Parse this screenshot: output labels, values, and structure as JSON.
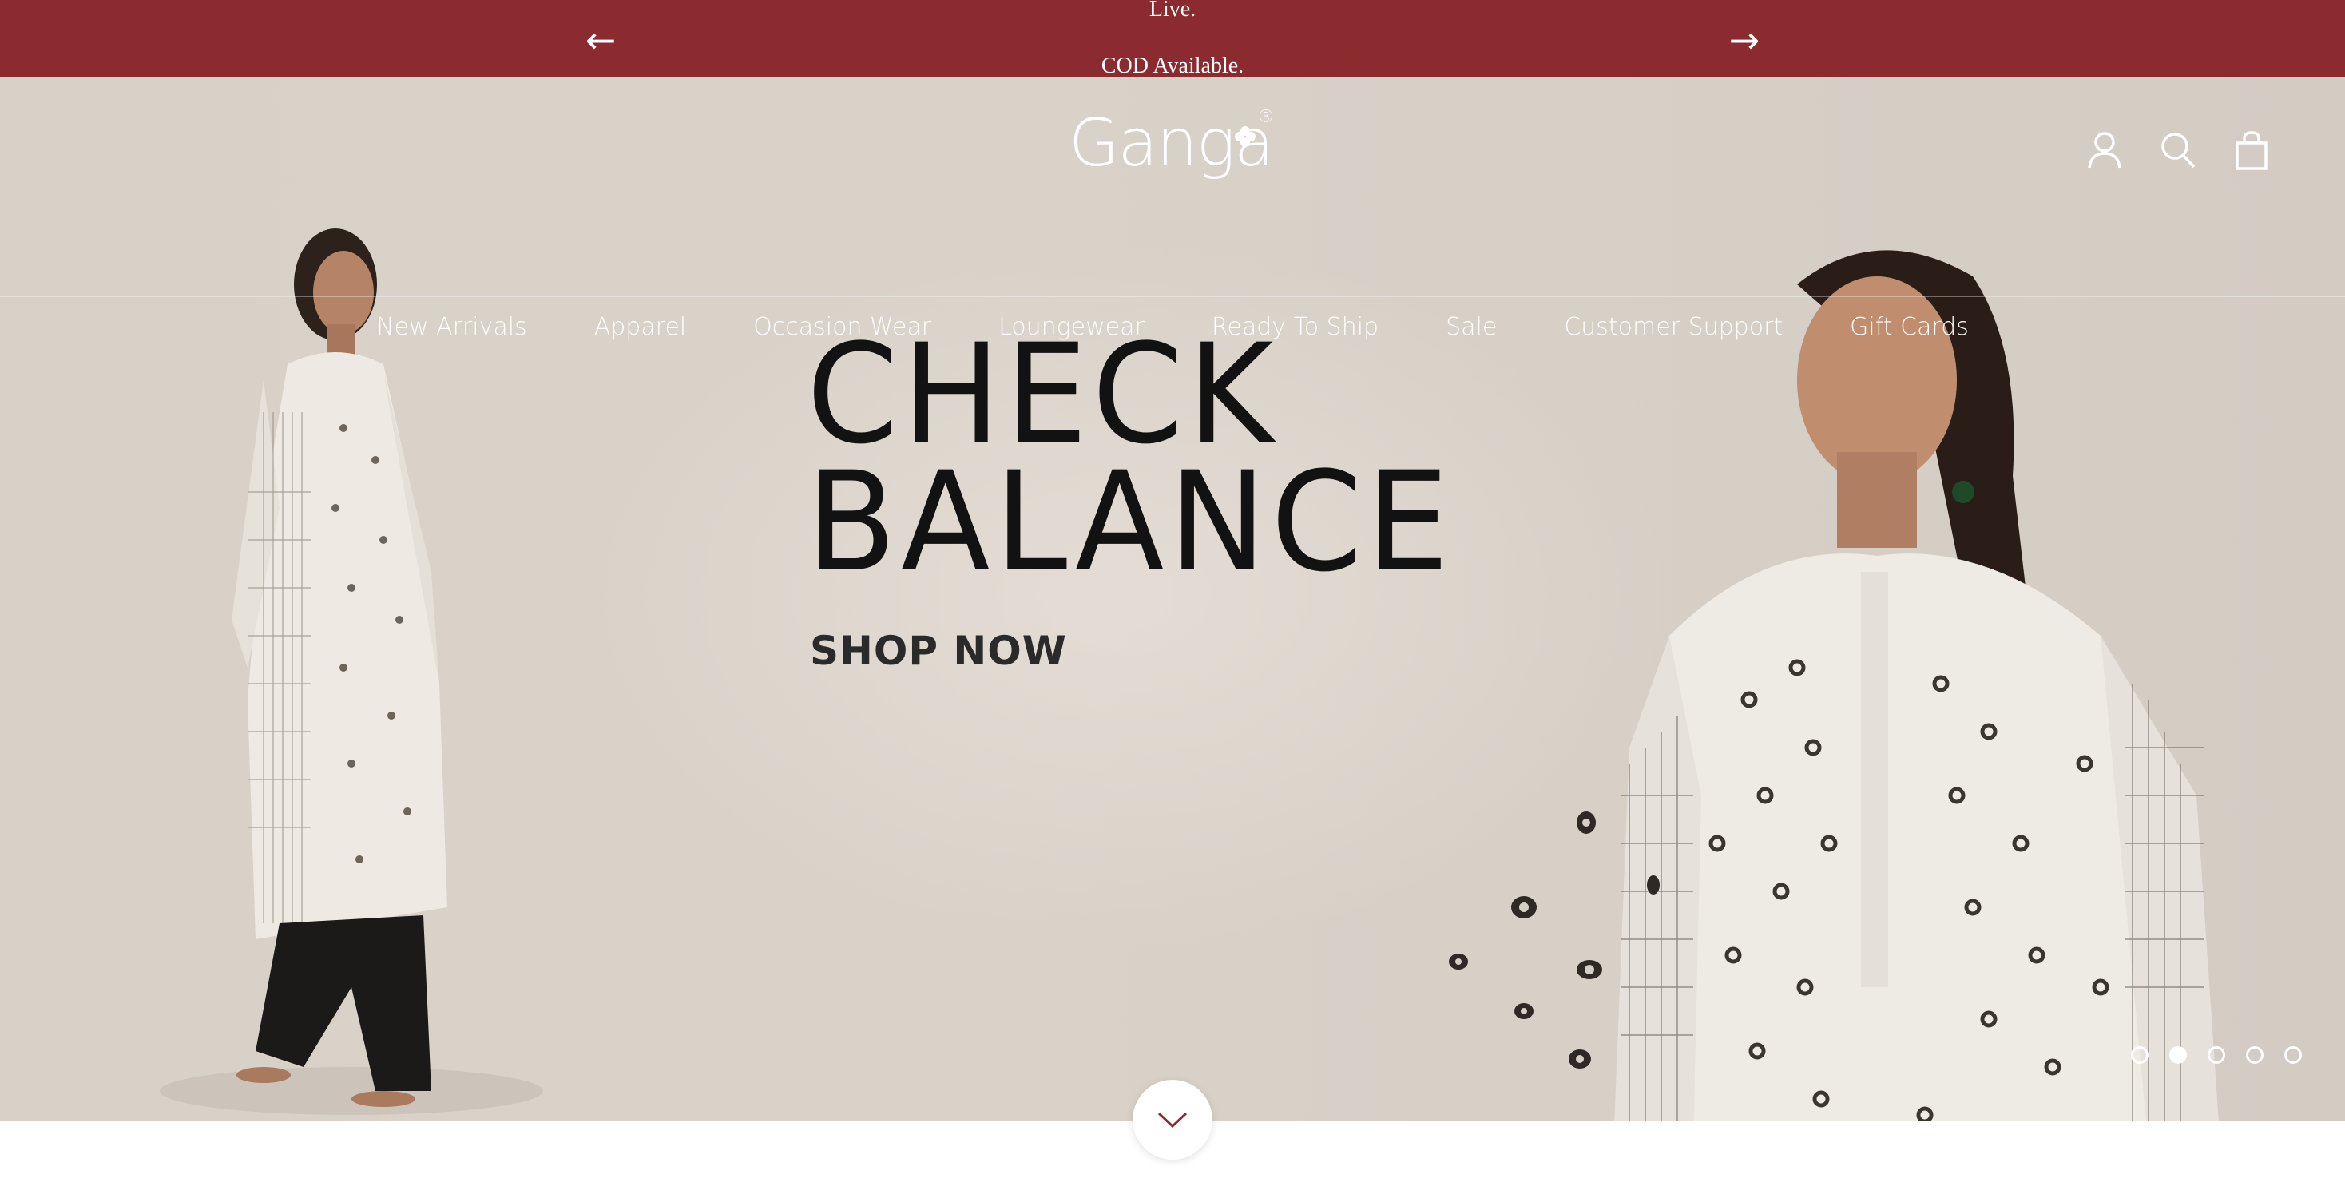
{
  "announcement": {
    "line1": "Live.",
    "line2": "COD Available.",
    "prev_icon": "arrow-left-icon",
    "next_icon": "arrow-right-icon"
  },
  "header": {
    "logo_text": "Ganga",
    "logo_mark": "®",
    "icons": [
      "account-icon",
      "search-icon",
      "cart-icon"
    ]
  },
  "nav": {
    "items": [
      {
        "label": "New Arrivals"
      },
      {
        "label": "Apparel"
      },
      {
        "label": "Occasion Wear"
      },
      {
        "label": "Loungewear"
      },
      {
        "label": "Ready To Ship"
      },
      {
        "label": "Sale"
      },
      {
        "label": "Customer Support"
      },
      {
        "label": "Gift Cards"
      }
    ]
  },
  "hero": {
    "headline_line1": "CHECK",
    "headline_line2": "BALANCE",
    "cta": "SHOP NOW",
    "slides_count": 5,
    "active_slide": 2
  },
  "colors": {
    "announcement_bg": "#8b2b2f",
    "hero_bg": "#d8d1c8",
    "headline": "#121212"
  }
}
